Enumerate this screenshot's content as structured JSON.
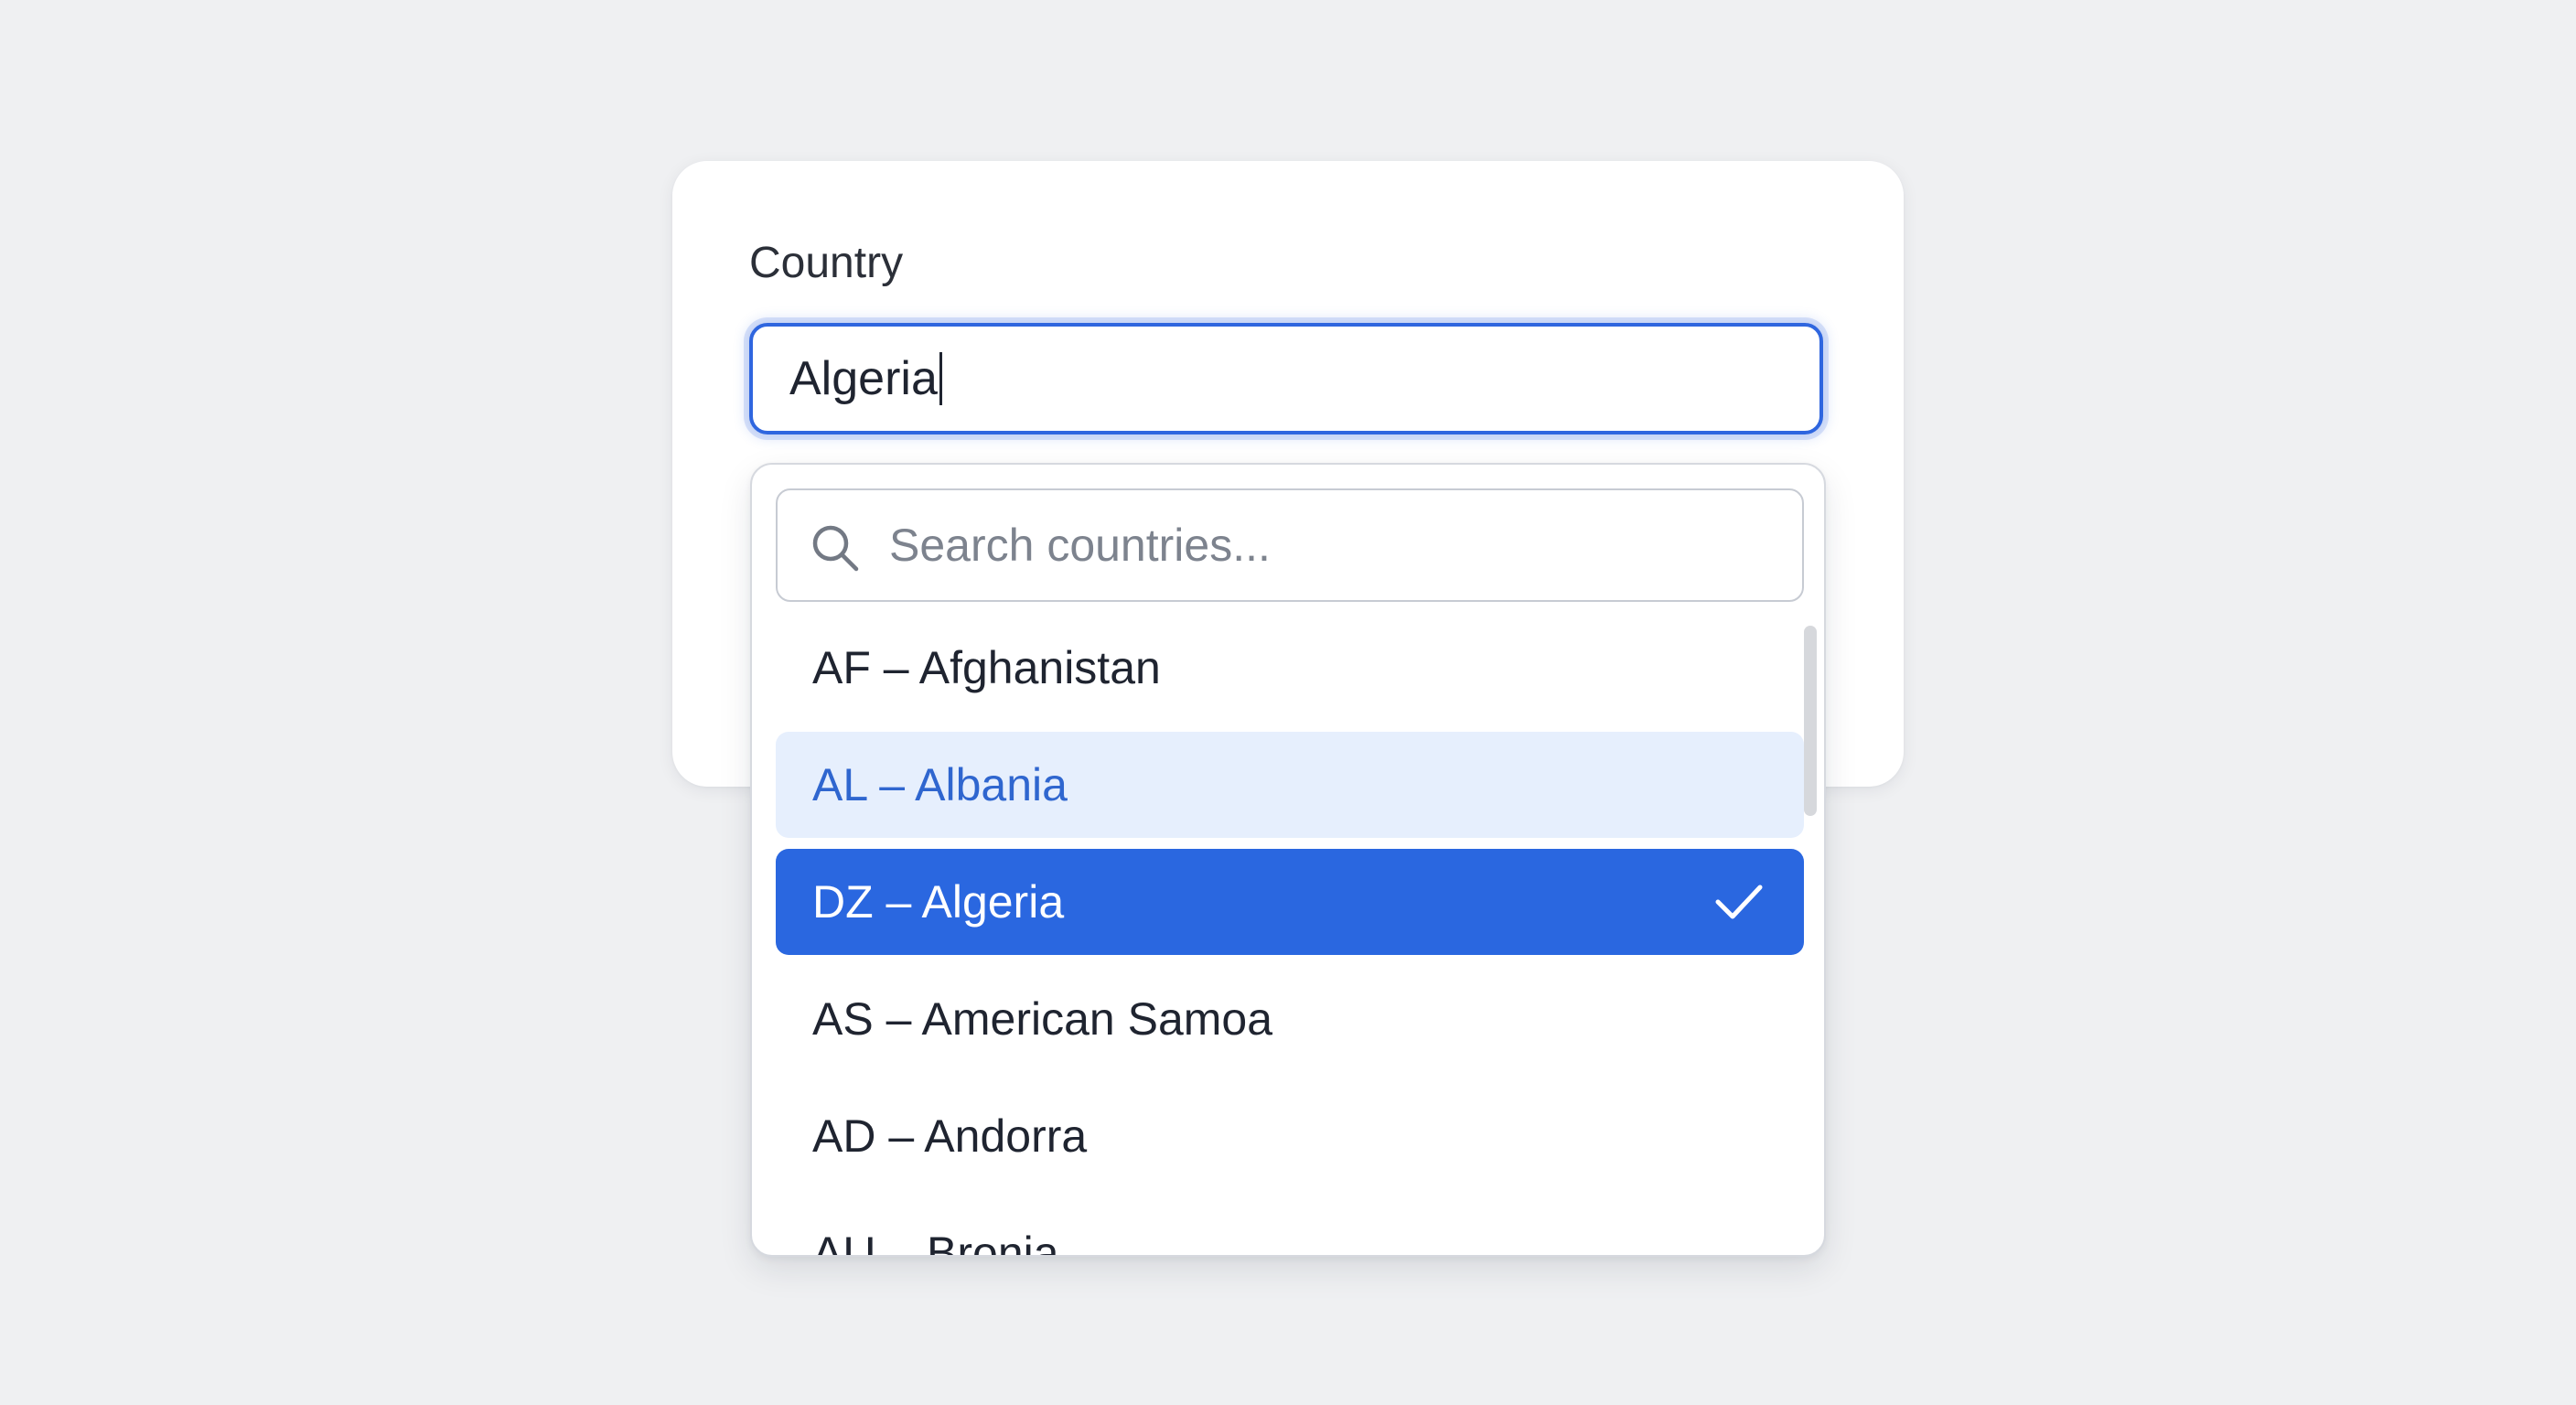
{
  "form": {
    "label": "Country",
    "input_value": "Algeria"
  },
  "dropdown": {
    "search_placeholder": "Search countries...",
    "search_icon": "search-icon",
    "check_icon": "check-icon",
    "options": [
      {
        "code": "AF",
        "name": "Afghanistan",
        "label": "AF – Afghanistan",
        "state": "default"
      },
      {
        "code": "AL",
        "name": "Albania",
        "label": "AL – Albania",
        "state": "hovered"
      },
      {
        "code": "DZ",
        "name": "Algeria",
        "label": "DZ – Algeria",
        "state": "selected"
      },
      {
        "code": "AS",
        "name": "American Samoa",
        "label": "AS – American Samoa",
        "state": "default"
      },
      {
        "code": "AD",
        "name": "Andorra",
        "label": "AD – Andorra",
        "state": "default"
      },
      {
        "code": "AU",
        "name": "Bronia",
        "label": "AU – Bronia",
        "state": "default"
      }
    ]
  },
  "colors": {
    "accent": "#2a67e0",
    "hover_bg": "#e6effd",
    "hover_text": "#2f66cf",
    "background": "#eff0f2"
  }
}
